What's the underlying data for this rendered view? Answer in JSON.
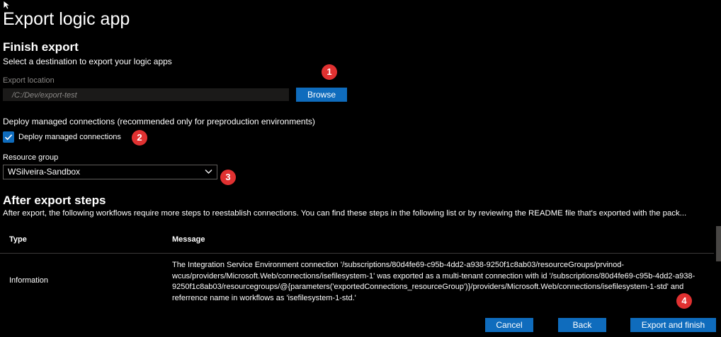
{
  "page": {
    "title": "Export logic app"
  },
  "finish_export": {
    "heading": "Finish export",
    "subtitle": "Select a destination to export your logic apps"
  },
  "export_location": {
    "label": "Export location",
    "placeholder": "/C:/Dev/export-test",
    "browse_label": "Browse"
  },
  "managed_connections": {
    "description": "Deploy managed connections (recommended only for preproduction environments)",
    "checkbox_label": "Deploy managed connections",
    "checked": true
  },
  "resource_group": {
    "label": "Resource group",
    "selected": "WSilveira-Sandbox"
  },
  "after_export": {
    "heading": "After export steps",
    "description": "After export, the following workflows require more steps to reestablish connections. You can find these steps in the following list or by reviewing the README file that's exported with the pack..."
  },
  "table": {
    "columns": [
      "Type",
      "Message"
    ],
    "rows": [
      {
        "type": "Information",
        "message": "The Integration Service Environment connection '/subscriptions/80d4fe69-c95b-4dd2-a938-9250f1c8ab03/resourceGroups/prvinod-wcus/providers/Microsoft.Web/connections/isefilesystem-1' was exported as a multi-tenant connection with id '/subscriptions/80d4fe69-c95b-4dd2-a938-9250f1c8ab03/resourcegroups/@{parameters('exportedConnections_resourceGroup')}/providers/Microsoft.Web/connections/isefilesystem-1-std' and referrence name in workflows as 'isefilesystem-1-std.'"
      }
    ]
  },
  "footer": {
    "cancel_label": "Cancel",
    "back_label": "Back",
    "export_label": "Export and finish"
  },
  "annotations": [
    "1",
    "2",
    "3",
    "4"
  ],
  "colors": {
    "background": "#000000",
    "primary_button": "#0f6cbd",
    "annotation_badge": "#e03131",
    "muted_text": "#8a8886"
  },
  "icons": [
    "mouse-cursor-icon",
    "checkmark-icon",
    "chevron-down-icon"
  ]
}
